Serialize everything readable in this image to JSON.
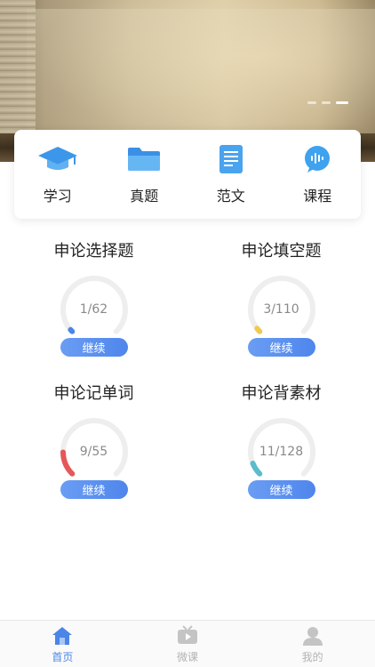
{
  "quick_links": [
    {
      "label": "学习",
      "icon": "graduation-cap-icon"
    },
    {
      "label": "真题",
      "icon": "folder-icon"
    },
    {
      "label": "范文",
      "icon": "document-icon"
    },
    {
      "label": "课程",
      "icon": "audio-chat-icon"
    }
  ],
  "progress_cards": [
    {
      "title": "申论选择题",
      "progress_text": "1/62",
      "done": 1,
      "total": 62,
      "color": "#4a86e8",
      "button": "继续"
    },
    {
      "title": "申论填空题",
      "progress_text": "3/110",
      "done": 3,
      "total": 110,
      "color": "#f2c94c",
      "button": "继续"
    },
    {
      "title": "申论记单词",
      "progress_text": "9/55",
      "done": 9,
      "total": 55,
      "color": "#e5585a",
      "button": "继续"
    },
    {
      "title": "申论背素材",
      "progress_text": "11/128",
      "done": 11,
      "total": 128,
      "color": "#5bbccb",
      "button": "继续"
    }
  ],
  "tabs": [
    {
      "label": "首页",
      "icon": "home-icon",
      "active": true
    },
    {
      "label": "微课",
      "icon": "video-icon",
      "active": false
    },
    {
      "label": "我的",
      "icon": "user-icon",
      "active": false
    }
  ],
  "colors": {
    "accent": "#4a86e8",
    "inactive": "#b3b3b3",
    "ring_track": "#eeeeee"
  },
  "banner": {
    "slide_count": 3,
    "active_slide": 3
  }
}
